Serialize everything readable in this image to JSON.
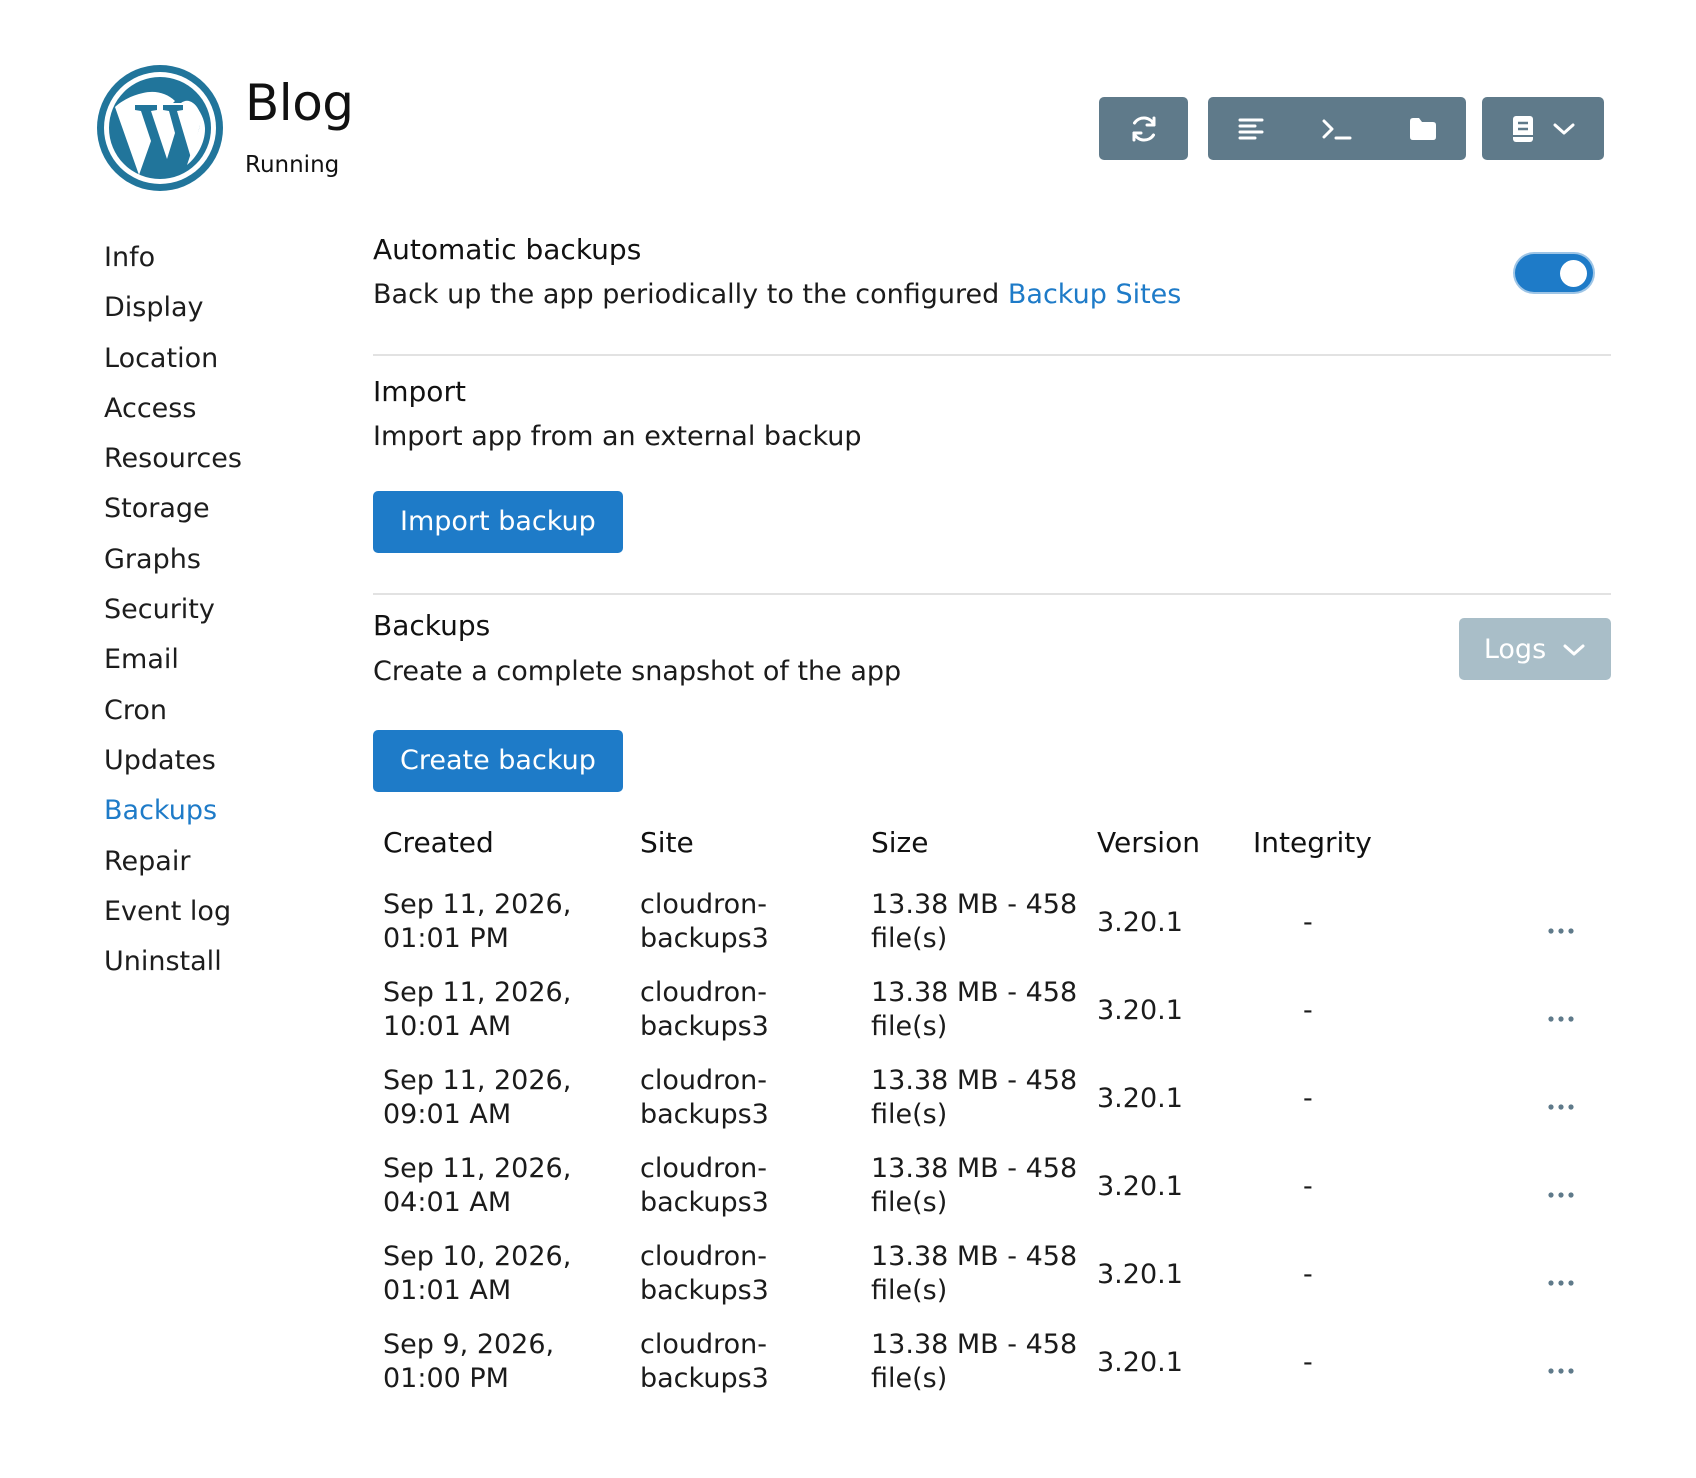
{
  "app": {
    "title": "Blog",
    "status": "Running",
    "logo_icon": "wordpress-logo-icon"
  },
  "toolbar": {
    "restart_icon": "refresh-icon",
    "logs_icon": "logs-icon",
    "terminal_icon": "terminal-icon",
    "files_icon": "folder-icon",
    "docs_icon": "book-icon",
    "accent": "#5f7a8a"
  },
  "sidebar": {
    "items": [
      {
        "label": "Info"
      },
      {
        "label": "Display"
      },
      {
        "label": "Location"
      },
      {
        "label": "Access"
      },
      {
        "label": "Resources"
      },
      {
        "label": "Storage"
      },
      {
        "label": "Graphs"
      },
      {
        "label": "Security"
      },
      {
        "label": "Email"
      },
      {
        "label": "Cron"
      },
      {
        "label": "Updates"
      },
      {
        "label": "Backups",
        "active": true
      },
      {
        "label": "Repair"
      },
      {
        "label": "Event log"
      },
      {
        "label": "Uninstall"
      }
    ]
  },
  "auto_backups": {
    "title": "Automatic backups",
    "desc": "Back up the app periodically to the configured ",
    "link": "Backup Sites",
    "enabled": true
  },
  "import": {
    "title": "Import",
    "desc": "Import app from an external backup",
    "button": "Import backup"
  },
  "backups": {
    "title": "Backups",
    "desc": "Create a complete snapshot of the app",
    "button": "Create backup",
    "logs_button": "Logs",
    "columns": [
      "Created",
      "Site",
      "Size",
      "Version",
      "Integrity"
    ],
    "rows": [
      {
        "created_1": "Sep 11, 2026,",
        "created_2": "01:01 PM",
        "site_1": "cloudron-",
        "site_2": "backups3",
        "size_1": "13.38 MB - 458",
        "size_2": "file(s)",
        "version": "3.20.1",
        "integrity": "-"
      },
      {
        "created_1": "Sep 11, 2026,",
        "created_2": "10:01 AM",
        "site_1": "cloudron-",
        "site_2": "backups3",
        "size_1": "13.38 MB - 458",
        "size_2": "file(s)",
        "version": "3.20.1",
        "integrity": "-"
      },
      {
        "created_1": "Sep 11, 2026,",
        "created_2": "09:01 AM",
        "site_1": "cloudron-",
        "site_2": "backups3",
        "size_1": "13.38 MB - 458",
        "size_2": "file(s)",
        "version": "3.20.1",
        "integrity": "-"
      },
      {
        "created_1": "Sep 11, 2026,",
        "created_2": "04:01 AM",
        "site_1": "cloudron-",
        "site_2": "backups3",
        "size_1": "13.38 MB - 458",
        "size_2": "file(s)",
        "version": "3.20.1",
        "integrity": "-"
      },
      {
        "created_1": "Sep 10, 2026,",
        "created_2": "01:01 AM",
        "site_1": "cloudron-",
        "site_2": "backups3",
        "size_1": "13.38 MB - 458",
        "size_2": "file(s)",
        "version": "3.20.1",
        "integrity": "-"
      },
      {
        "created_1": "Sep 9, 2026,",
        "created_2": "01:00 PM",
        "site_1": "cloudron-",
        "site_2": "backups3",
        "size_1": "13.38 MB - 458",
        "size_2": "file(s)",
        "version": "3.20.1",
        "integrity": "-"
      }
    ]
  },
  "colors": {
    "primary": "#1e7bc8",
    "toolbar": "#5f7a8a",
    "logs_disabled": "#a9bec8"
  }
}
